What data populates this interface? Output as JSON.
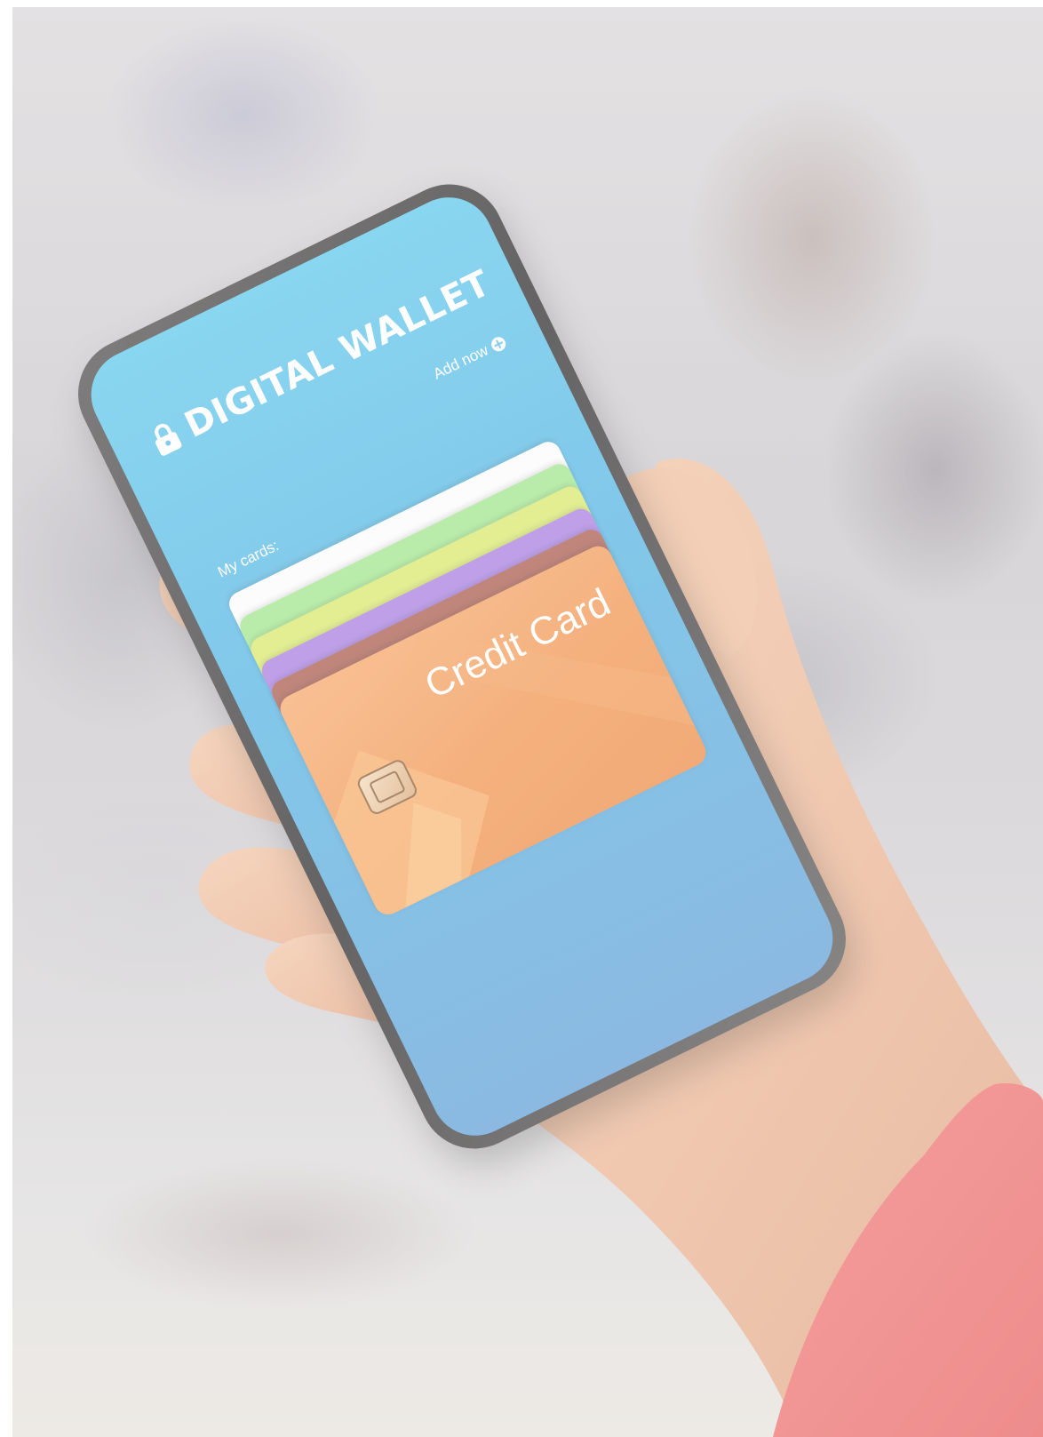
{
  "app": {
    "title": "DIGITAL WALLET",
    "add_new_label": "Add now",
    "my_cards_label": "My cards:",
    "featured_card_title": "Credit Card"
  },
  "colors": {
    "screen_top": "#5cc6ea",
    "screen_bottom": "#5f9fd6",
    "card_main": "#f0924c",
    "stack": [
      "#ffffff",
      "#9ee58a",
      "#d8e86a",
      "#a57be0",
      "#a8584a"
    ]
  },
  "icons": {
    "lock": "lock-icon",
    "add": "plus-circle-icon",
    "chip": "card-chip-icon"
  }
}
